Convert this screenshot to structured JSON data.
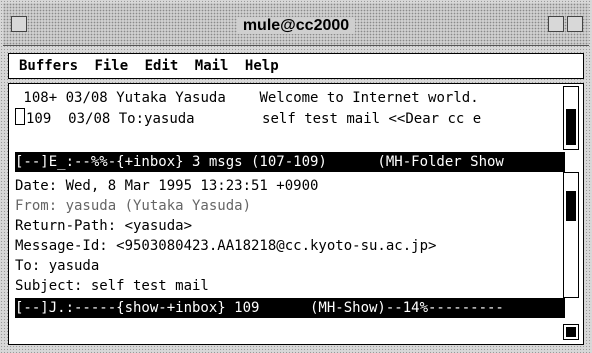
{
  "window": {
    "title": "mule@cc2000"
  },
  "menubar": {
    "items": [
      "Buffers",
      "File",
      "Edit",
      "Mail",
      "Help"
    ]
  },
  "folder": {
    "messages": [
      {
        "num": " 108+",
        "date": "03/08",
        "from": "Yutaka Yasuda  ",
        "subject": "Welcome to Internet world."
      },
      {
        "num": "109 ",
        "date": "03/08",
        "from": "To:yasuda      ",
        "subject": "self test mail <<Dear cc e"
      }
    ],
    "modeline": "[--]E_:--%%-{+inbox} 3 msgs (107-109)      (MH-Folder Show"
  },
  "show": {
    "headers": [
      "Date: Wed, 8 Mar 1995 13:23:51 +0900",
      "From: yasuda (Yutaka Yasuda)",
      "Return-Path: <yasuda>",
      "Message-Id: <9503080423.AA18218@cc.kyoto-su.ac.jp>",
      "To: yasuda",
      "Subject: self test mail"
    ],
    "modeline": "[--]J.:-----{show-+inbox} 109      (MH-Show)--14%---------"
  }
}
